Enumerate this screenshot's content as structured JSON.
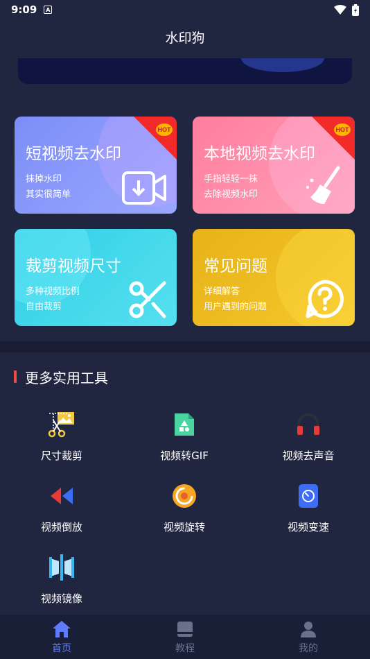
{
  "status": {
    "time": "9:09",
    "a_icon": "A"
  },
  "header": {
    "title": "水印狗"
  },
  "cards": [
    {
      "title": "短视频去水印",
      "sub1": "抹掉水印",
      "sub2": "其实很简单",
      "badge": "HOT",
      "icon": "video-download-icon"
    },
    {
      "title": "本地视频去水印",
      "sub1": "手指轻轻一抹",
      "sub2": "去除视频水印",
      "badge": "HOT",
      "icon": "broom-icon"
    },
    {
      "title": "裁剪视频尺寸",
      "sub1": "多种视频比例",
      "sub2": "自由裁剪",
      "icon": "scissors-icon"
    },
    {
      "title": "常见问题",
      "sub1": "详细解答",
      "sub2": "用户遇到的问题",
      "icon": "question-bubble-icon"
    }
  ],
  "section": {
    "title": "更多实用工具"
  },
  "tools": [
    {
      "label": "尺寸裁剪",
      "icon": "crop-scissors-icon"
    },
    {
      "label": "视频转GIF",
      "icon": "gif-file-icon"
    },
    {
      "label": "视频去声音",
      "icon": "headphones-icon"
    },
    {
      "label": "视频倒放",
      "icon": "rewind-icon"
    },
    {
      "label": "视频旋转",
      "icon": "rotate-icon"
    },
    {
      "label": "视频变速",
      "icon": "speed-icon"
    },
    {
      "label": "视频镜像",
      "icon": "mirror-icon"
    }
  ],
  "nav": [
    {
      "label": "首页",
      "icon": "home-icon",
      "active": true
    },
    {
      "label": "教程",
      "icon": "book-icon",
      "active": false
    },
    {
      "label": "我的",
      "icon": "user-icon",
      "active": false
    }
  ],
  "colors": {
    "background": "#202640",
    "accent": "#5f7bff",
    "section_bar": "#f04b4b"
  }
}
